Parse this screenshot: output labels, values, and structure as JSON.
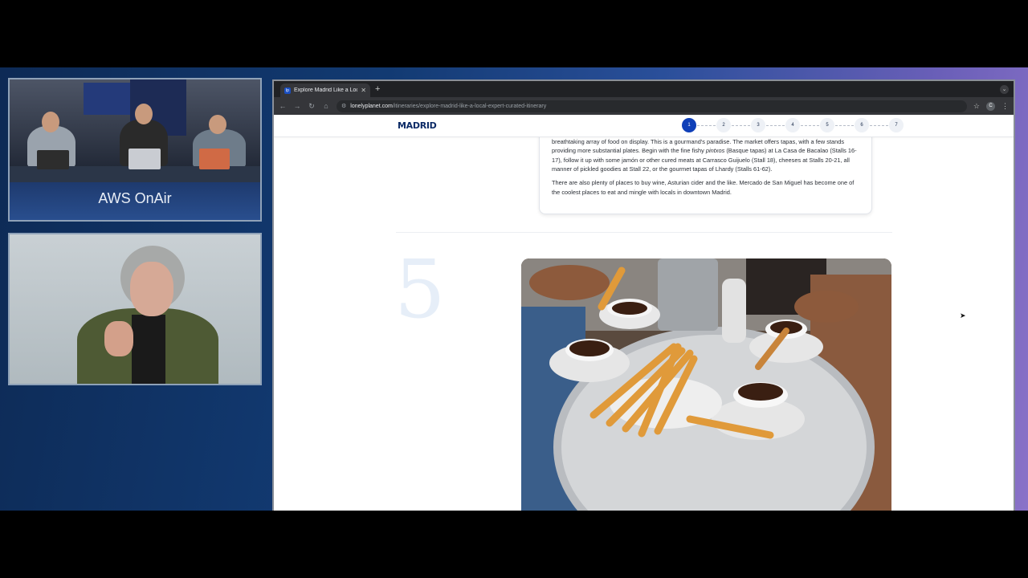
{
  "studio": {
    "banner": "AWS OnAir"
  },
  "browser": {
    "tab_title": "Explore Madrid Like a Local",
    "favicon": "lp",
    "new_tab": "+",
    "url_host": "lonelyplanet.com",
    "url_path": "/itineraries/explore-madrid-like-a-local-expert-curated-itinerary",
    "profile_initial": "C"
  },
  "site": {
    "logo": "MADRID",
    "steps": [
      "1",
      "2",
      "3",
      "4",
      "5",
      "6",
      "7"
    ],
    "active_step": 1
  },
  "article": {
    "p1_a": "century-old glass-and-wrought-iron facade near Plaza Mayor, you'll find an inviting space strewn with tables and a breathtaking array of food on display. This is a gourmand's paradise. The market offers tapas, with a few stands providing more substantial plates. Begin with the fine fishy ",
    "p1_em": "pintxos",
    "p1_b": " (Basque tapas) at La Casa de Bacalao (Stalls 16-17), follow it up with some jamón or other cured meats at Carrasco Guijuelo (Stall 18), cheeses at Stalls 20-21, all manner of pickled goodies at Stall 22, or the gourmet tapas of Lhardy (Stalls 61-62).",
    "p2": "There are also plenty of places to buy wine, Asturian cider and the like. Mercado de San Miguel has become one of the coolest places to eat and mingle with locals in downtown Madrid.",
    "section_number": "5"
  },
  "colors": {
    "brand_navy": "#0b2a66",
    "active_step": "#0f3fb8",
    "backdrop_start": "#0d2a55",
    "backdrop_end": "#8a72c8"
  }
}
